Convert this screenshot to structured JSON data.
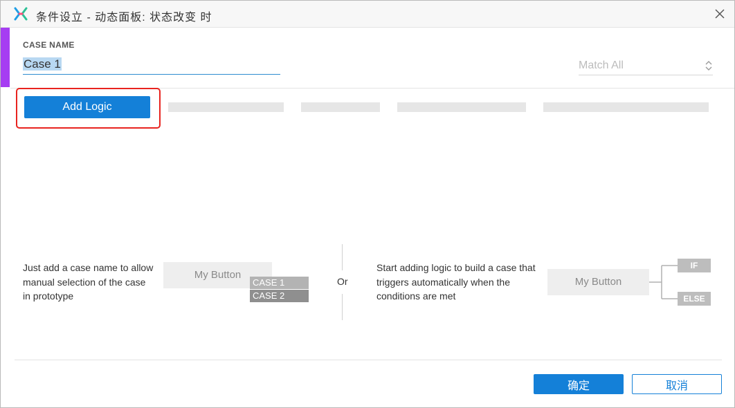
{
  "window": {
    "title": "条件设立  -  动态面板: 状态改变 时"
  },
  "case": {
    "label": "CASE NAME",
    "value": "Case 1"
  },
  "match": {
    "selected": "Match All"
  },
  "toolbar": {
    "add_logic_label": "Add Logic"
  },
  "hints": {
    "manual": "Just add a case name to allow manual selection of the case in prototype",
    "manual_button": "My Button",
    "case_tags": [
      "CASE 1",
      "CASE 2"
    ],
    "or": "Or",
    "auto": "Start adding logic to build a case that triggers automatically when the conditions are met",
    "auto_button": "My Button",
    "branch_if": "IF",
    "branch_else": "ELSE"
  },
  "footer": {
    "ok_label": "确定",
    "cancel_label": "取消"
  },
  "colors": {
    "accent": "#a63df2",
    "primary": "#1480d8",
    "highlight": "#e8231f"
  },
  "icons": {
    "app_logo": "axure-logo-icon",
    "close": "close-icon",
    "select": "chevron-up-down-icon"
  }
}
